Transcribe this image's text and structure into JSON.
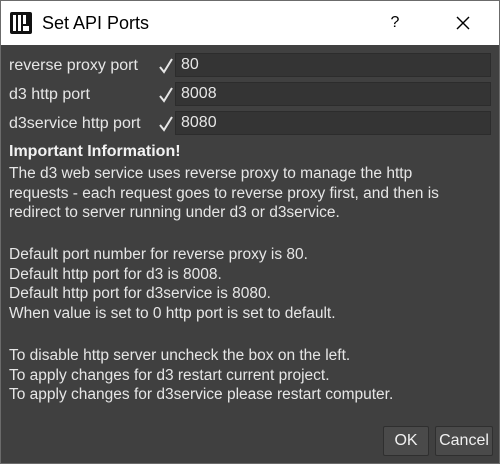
{
  "window": {
    "title": "Set API Ports",
    "help_label": "?",
    "icon": "app-logo-icon",
    "close_icon": "close-icon"
  },
  "ports": [
    {
      "label": "reverse proxy port",
      "enabled": true,
      "value": "80"
    },
    {
      "label": "d3 http port",
      "enabled": true,
      "value": "8008"
    },
    {
      "label": "d3service http port",
      "enabled": true,
      "value": "8080"
    }
  ],
  "info": {
    "heading": "Important Information!",
    "para1": [
      "The d3 web service uses reverse proxy to manage the http",
      "requests - each request goes to reverse proxy first, and then is",
      "redirect to server running under d3 or d3service."
    ],
    "para2": [
      "Default port number for reverse proxy is 80.",
      "Default http port for d3 is 8008.",
      "Default http port for d3service is 8080.",
      "When value is set to 0 http port is set to default."
    ],
    "para3": [
      "To disable http server uncheck the box on the left.",
      "To apply changes for d3 restart current project.",
      "To apply changes for d3service please restart computer."
    ]
  },
  "buttons": {
    "ok": "OK",
    "cancel": "Cancel"
  },
  "colors": {
    "dialog_bg": "#404040",
    "titlebar_bg": "#ffffff",
    "input_bg": "#343434",
    "text": "#e6e6e6",
    "checkmark": "#e6e6e6"
  }
}
